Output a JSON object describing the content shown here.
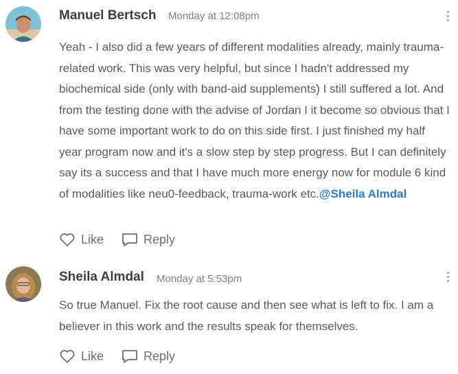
{
  "comments": [
    {
      "author": "Manuel Bertsch",
      "time": "Monday at 12:08pm",
      "text": "Yeah - I also did a few years of different modalities already, mainly trauma-related work. This was very helpful, but since I hadn't addressed my biochemical side (only with band-aid supplements) I still suffered a lot. And from the testing done with the advise of Jordan I it become so obvious that I have some important work to do on this side first. I just finished my half year program now and it's a slow step by step progress. But I can definitely say its a success and that I have much more energy now for module 6 kind of modalities like neu0-feedback, trauma-work etc.",
      "mention": "@Sheila Almdal",
      "like_label": "Like",
      "reply_label": "Reply"
    },
    {
      "author": "Sheila Almdal",
      "time": "Monday at 5:53pm",
      "text": "So true Manuel. Fix the root cause and then see what is left to fix. I am a believer in this work and the results speak for themselves.",
      "like_label": "Like",
      "reply_label": "Reply"
    }
  ],
  "icons": {
    "like": "heart-icon",
    "reply": "comment-icon",
    "more": "vertical-dots-icon"
  },
  "colors": {
    "mention": "#2b7bc9",
    "author": "#3b3f45",
    "timestamp": "#7b8087"
  }
}
